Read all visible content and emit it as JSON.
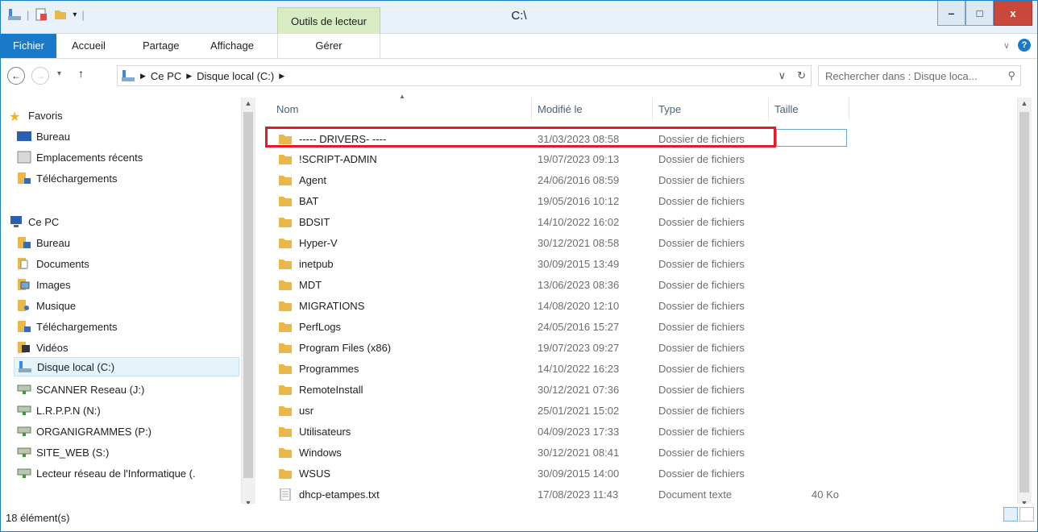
{
  "window": {
    "title": "C:\\",
    "context_tab": "Outils de lecteur",
    "ribbon_tabs": [
      "Fichier",
      "Accueil",
      "Partage",
      "Affichage"
    ],
    "context_ribbon_tab": "Gérer",
    "minimize": "‒",
    "maximize": "□",
    "close": "x"
  },
  "address": {
    "crumbs": [
      "Ce PC",
      "Disque local (C:)"
    ],
    "search_placeholder": "Rechercher dans : Disque loca..."
  },
  "nav": {
    "favorites": "Favoris",
    "fav_items": [
      "Bureau",
      "Emplacements récents",
      "Téléchargements"
    ],
    "this_pc": "Ce PC",
    "pc_items": [
      "Bureau",
      "Documents",
      "Images",
      "Musique",
      "Téléchargements",
      "Vidéos",
      "Disque local (C:)",
      "SCANNER Reseau (J:)",
      "L.R.P.P.N (N:)",
      "ORGANIGRAMMES (P:)",
      "SITE_WEB (S:)",
      "Lecteur réseau de l'Informatique (."
    ]
  },
  "columns": {
    "name": "Nom",
    "modified": "Modifié le",
    "type": "Type",
    "size": "Taille"
  },
  "files": [
    {
      "name": "----- DRIVERS- ----",
      "date": "31/03/2023 08:58",
      "type": "Dossier de fichiers",
      "size": ""
    },
    {
      "name": "!SCRIPT-ADMIN",
      "date": "19/07/2023 09:13",
      "type": "Dossier de fichiers",
      "size": ""
    },
    {
      "name": "Agent",
      "date": "24/06/2016 08:59",
      "type": "Dossier de fichiers",
      "size": ""
    },
    {
      "name": "BAT",
      "date": "19/05/2016 10:12",
      "type": "Dossier de fichiers",
      "size": ""
    },
    {
      "name": "BDSIT",
      "date": "14/10/2022 16:02",
      "type": "Dossier de fichiers",
      "size": ""
    },
    {
      "name": "Hyper-V",
      "date": "30/12/2021 08:58",
      "type": "Dossier de fichiers",
      "size": ""
    },
    {
      "name": "inetpub",
      "date": "30/09/2015 13:49",
      "type": "Dossier de fichiers",
      "size": ""
    },
    {
      "name": "MDT",
      "date": "13/06/2023 08:36",
      "type": "Dossier de fichiers",
      "size": ""
    },
    {
      "name": "MIGRATIONS",
      "date": "14/08/2020 12:10",
      "type": "Dossier de fichiers",
      "size": ""
    },
    {
      "name": "PerfLogs",
      "date": "24/05/2016 15:27",
      "type": "Dossier de fichiers",
      "size": ""
    },
    {
      "name": "Program Files (x86)",
      "date": "19/07/2023 09:27",
      "type": "Dossier de fichiers",
      "size": ""
    },
    {
      "name": "Programmes",
      "date": "14/10/2022 16:23",
      "type": "Dossier de fichiers",
      "size": ""
    },
    {
      "name": "RemoteInstall",
      "date": "30/12/2021 07:36",
      "type": "Dossier de fichiers",
      "size": ""
    },
    {
      "name": "usr",
      "date": "25/01/2021 15:02",
      "type": "Dossier de fichiers",
      "size": ""
    },
    {
      "name": "Utilisateurs",
      "date": "04/09/2023 17:33",
      "type": "Dossier de fichiers",
      "size": ""
    },
    {
      "name": "Windows",
      "date": "30/12/2021 08:41",
      "type": "Dossier de fichiers",
      "size": ""
    },
    {
      "name": "WSUS",
      "date": "30/09/2015 14:00",
      "type": "Dossier de fichiers",
      "size": ""
    },
    {
      "name": "dhcp-etampes.txt",
      "date": "17/08/2023 11:43",
      "type": "Document texte",
      "size": "40 Ko"
    }
  ],
  "status": {
    "count": "18 élément(s)"
  },
  "colors": {
    "accent": "#1979ca",
    "highlight": "#e21b2b",
    "folder": "#e8b84a"
  }
}
